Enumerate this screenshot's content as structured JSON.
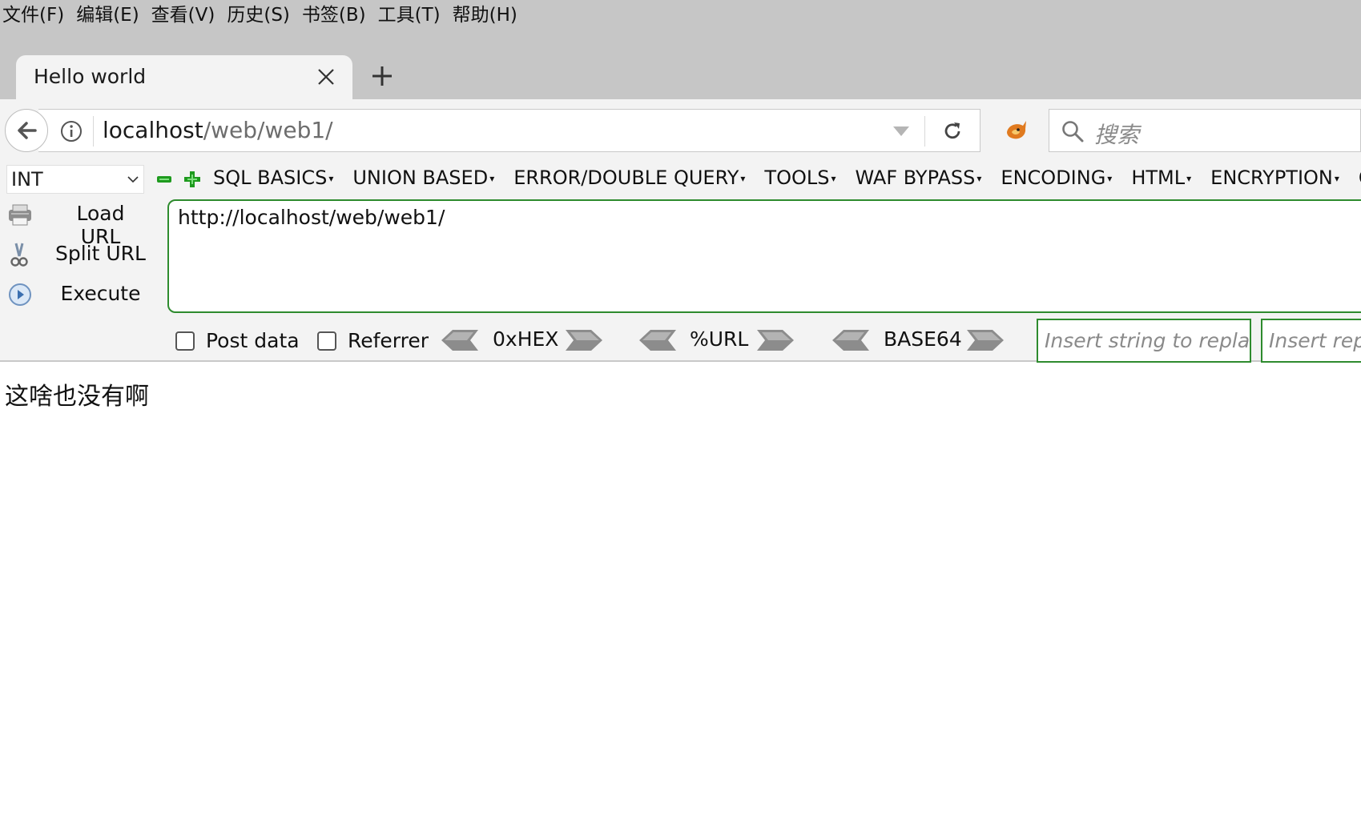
{
  "menubar": {
    "items": [
      {
        "label": "文件(F)"
      },
      {
        "label": "编辑(E)"
      },
      {
        "label": "查看(V)"
      },
      {
        "label": "历史(S)"
      },
      {
        "label": "书签(B)"
      },
      {
        "label": "工具(T)"
      },
      {
        "label": "帮助(H)"
      }
    ]
  },
  "tabs": {
    "active_title": "Hello world",
    "close_icon": "close-icon",
    "new_tab_icon": "plus-icon"
  },
  "navbar": {
    "back_icon": "arrow-left-icon",
    "info_icon": "info-icon",
    "url_host": "localhost",
    "url_path": "/web/web1/",
    "reload_icon": "reload-icon",
    "addon_icon": "fox-addon-icon",
    "search_placeholder": "搜索"
  },
  "hackbar": {
    "type_select_value": "INT",
    "menus": [
      {
        "label": "SQL BASICS"
      },
      {
        "label": "UNION BASED"
      },
      {
        "label": "ERROR/DOUBLE QUERY"
      },
      {
        "label": "TOOLS"
      },
      {
        "label": "WAF BYPASS"
      },
      {
        "label": "ENCODING"
      },
      {
        "label": "HTML"
      },
      {
        "label": "ENCRYPTION"
      },
      {
        "label": "C"
      }
    ],
    "actions": {
      "load_url": "Load URL",
      "split_url": "Split URL",
      "execute": "Execute"
    },
    "textarea_value": "http://localhost/web/web1/",
    "post_data_label": "Post data",
    "post_data_checked": false,
    "referrer_label": "Referrer",
    "referrer_checked": false,
    "encoders": {
      "hex": "0xHEX",
      "url": "%URL",
      "base64": "BASE64"
    },
    "replace_placeholder": "Insert string to replace",
    "replacement_placeholder": "Insert replacing string"
  },
  "page": {
    "body_text": "这啥也没有啊"
  },
  "colors": {
    "chrome_bg": "#c6c6c6",
    "toolbar_bg": "#f3f3f3",
    "hackbar_accent": "#2e8b2e"
  }
}
